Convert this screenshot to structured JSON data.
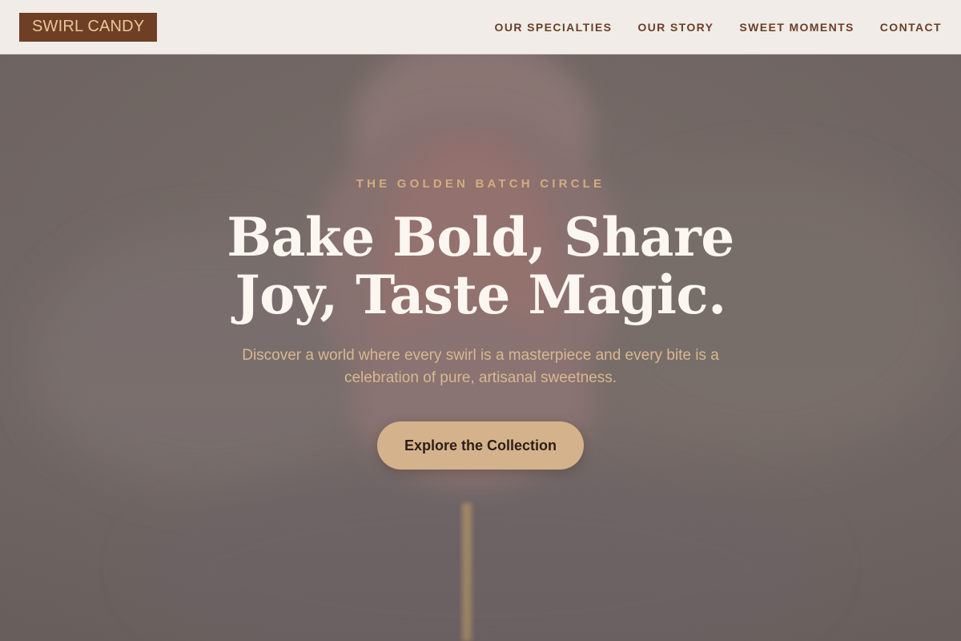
{
  "header": {
    "logo": "SWIRL CANDY",
    "nav": [
      {
        "label": "OUR SPECIALTIES"
      },
      {
        "label": "OUR STORY"
      },
      {
        "label": "SWEET MOMENTS"
      },
      {
        "label": "CONTACT"
      }
    ]
  },
  "hero": {
    "eyebrow": "THE GOLDEN BATCH CIRCLE",
    "headline": "Bake Bold, Share Joy, Taste Magic.",
    "subtext": "Discover a world where every swirl is a masterpiece and every bite is a celebration of pure, artisanal sweetness.",
    "cta_label": "Explore the Collection",
    "background_image": "cotton-candy-on-stick"
  },
  "colors": {
    "logo_bg": "#6e3f25",
    "logo_text": "#e8c79a",
    "nav_text": "#6a3e2a",
    "header_bg": "#f1ece7",
    "hero_overlay": "#756a66",
    "eyebrow": "#d2ad80",
    "headline": "#fbf6f0",
    "subtext": "#d9b88f",
    "cta_bg": "#d4b38c",
    "cta_text": "#2d1e16"
  }
}
